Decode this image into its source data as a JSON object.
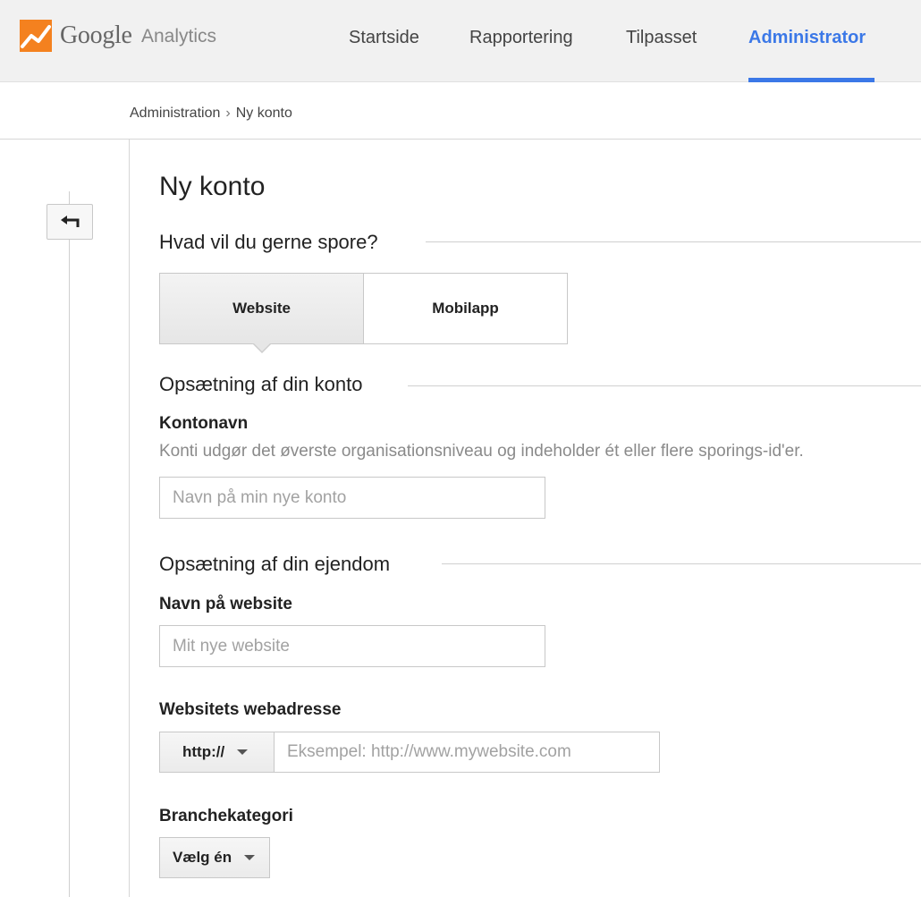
{
  "header": {
    "brand": "Google",
    "brand_sub": "Analytics",
    "nav": {
      "home": "Startside",
      "reporting": "Rapportering",
      "custom": "Tilpasset",
      "admin": "Administrator"
    },
    "accent_color": "#3b78e7"
  },
  "breadcrumb": {
    "root": "Administration",
    "separator": "›",
    "current": "Ny konto"
  },
  "page": {
    "title": "Ny konto",
    "back_icon": "back-arrow-icon"
  },
  "track": {
    "heading": "Hvad vil du gerne spore?",
    "options": {
      "website": "Website",
      "mobile": "Mobilapp"
    },
    "selected": "Website"
  },
  "account": {
    "heading": "Opsætning af din konto",
    "name_label": "Kontonavn",
    "name_help": "Konti udgør det øverste organisationsniveau og indeholder ét eller flere sporings-id'er.",
    "name_placeholder": "Navn på min nye konto"
  },
  "property": {
    "heading": "Opsætning af din ejendom",
    "site_name_label": "Navn på website",
    "site_name_placeholder": "Mit nye website",
    "url_label": "Websitets webadresse",
    "protocol": "http://",
    "url_placeholder": "Eksempel: http://www.mywebsite.com",
    "industry_label": "Branchekategori",
    "industry_value": "Vælg én"
  }
}
